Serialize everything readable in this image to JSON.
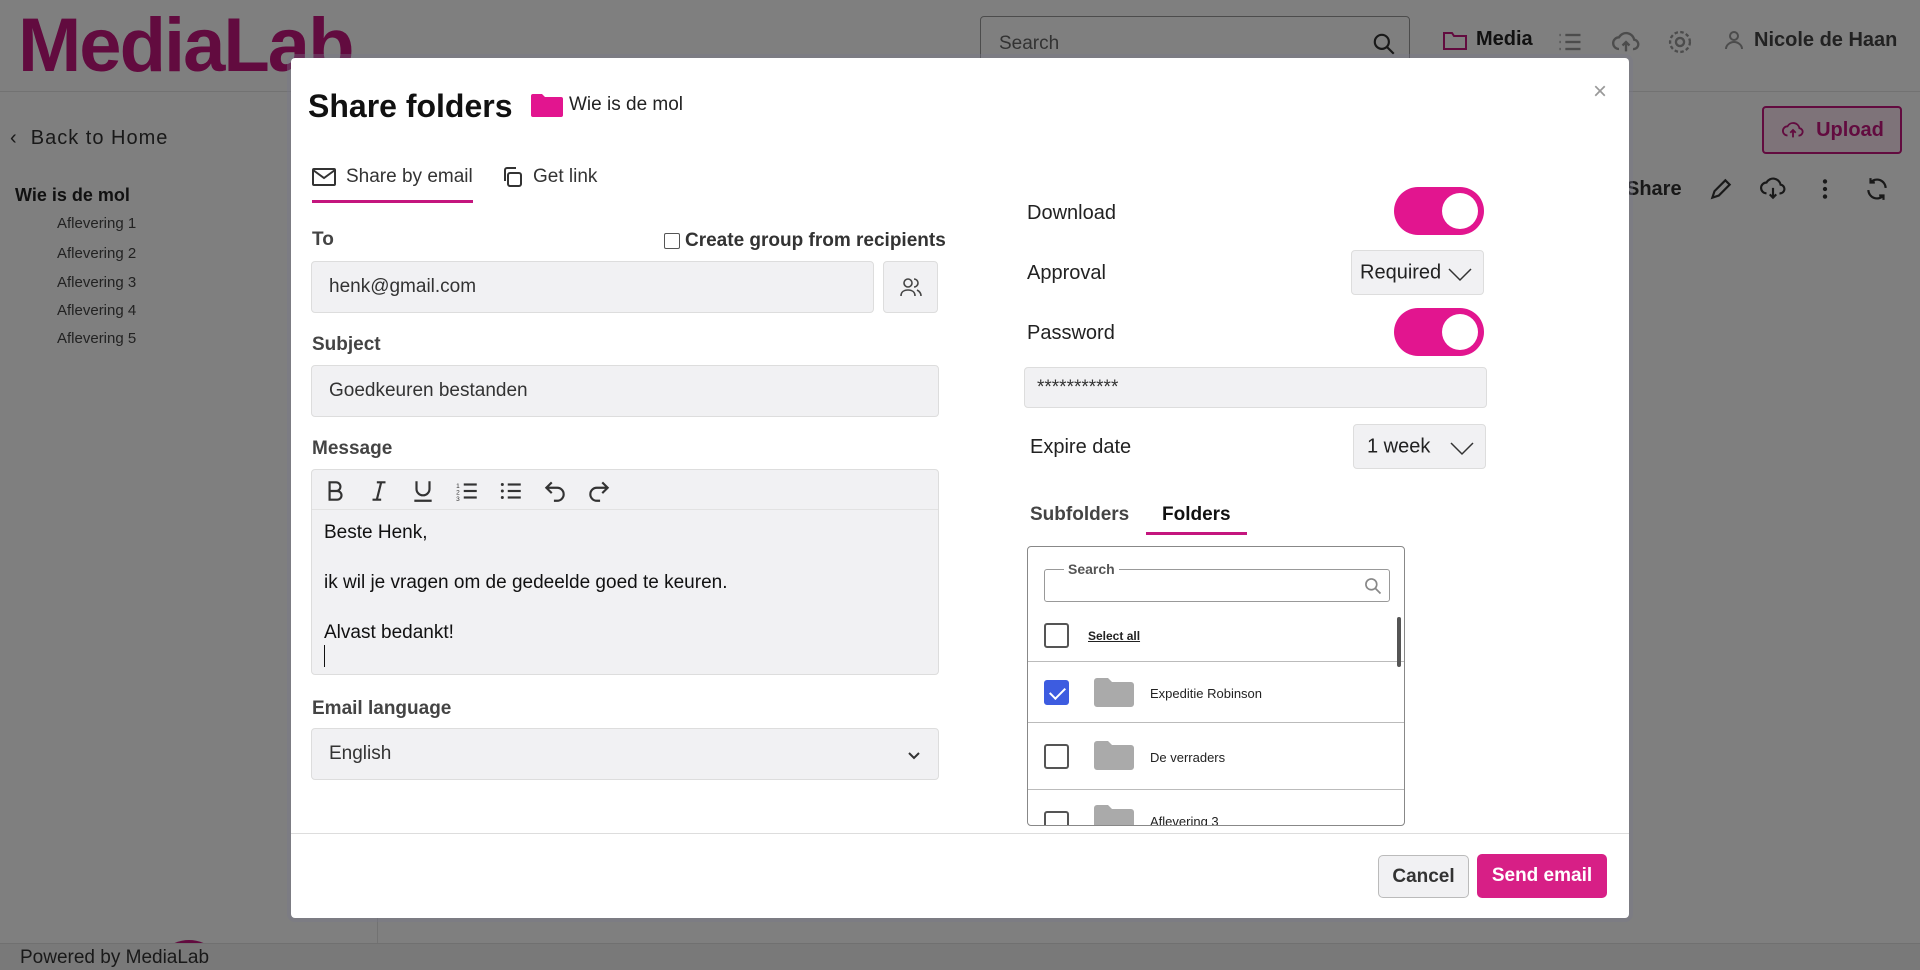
{
  "app": {
    "logo": "MediaLab",
    "search_placeholder": "Search",
    "media_label": "Media",
    "user_name": "Nicole de Haan",
    "upload_label": "Upload",
    "share_label": "Share",
    "footer": "Powered by MediaLab"
  },
  "sidebar": {
    "back_label": "Back to Home",
    "root": "Wie is de mol",
    "items": [
      "Aflevering 1",
      "Aflevering 2",
      "Aflevering 3",
      "Aflevering 4",
      "Aflevering 5"
    ]
  },
  "modal": {
    "title": "Share folders",
    "folder_name": "Wie is de mol",
    "close": "×",
    "tabs": [
      {
        "label": "Share by email",
        "active": true
      },
      {
        "label": "Get link",
        "active": false
      }
    ],
    "to_label": "To",
    "create_group_label": "Create group from recipients",
    "to_value": "henk@gmail.com",
    "subject_label": "Subject",
    "subject_value": "Goedkeuren bestanden",
    "message_label": "Message",
    "message_lines": [
      "Beste Henk,",
      "ik wil je vragen om de gedeelde goed te keuren.",
      "Alvast bedankt!"
    ],
    "email_language_label": "Email language",
    "email_language_value": "English",
    "download_label": "Download",
    "download_enabled": true,
    "approval_label": "Approval",
    "approval_value": "Required",
    "password_label": "Password",
    "password_enabled": true,
    "password_value": "***********",
    "expire_label": "Expire date",
    "expire_value": "1 week",
    "sub_tabs": [
      {
        "label": "Subfolders",
        "active": false
      },
      {
        "label": "Folders",
        "active": true
      }
    ],
    "folder_search_legend": "Search",
    "select_all_label": "Select all",
    "folders": [
      {
        "name": "Expeditie Robinson",
        "checked": true
      },
      {
        "name": "De verraders",
        "checked": false
      },
      {
        "name": "Aflevering 3",
        "checked": false
      }
    ],
    "cancel_label": "Cancel",
    "send_label": "Send email"
  },
  "colors": {
    "brand": "#c4167e",
    "toggle_on": "#e2158f",
    "checkbox_checked": "#3d5ce0"
  }
}
